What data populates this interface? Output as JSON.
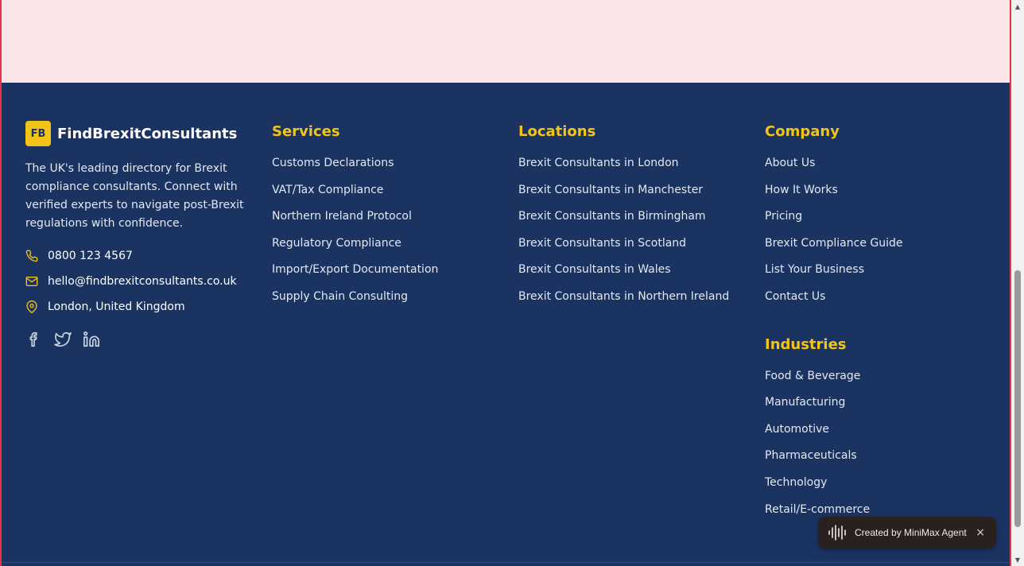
{
  "brand": {
    "badge": "FB",
    "name": "FindBrexitConsultants",
    "description": "The UK's leading directory for Brexit compliance consultants. Connect with verified experts to navigate post-Brexit regulations with confidence.",
    "phone": "0800 123 4567",
    "email": "hello@findbrexitconsultants.co.uk",
    "location": "London, United Kingdom"
  },
  "services": {
    "heading": "Services",
    "links": [
      "Customs Declarations",
      "VAT/Tax Compliance",
      "Northern Ireland Protocol",
      "Regulatory Compliance",
      "Import/Export Documentation",
      "Supply Chain Consulting"
    ]
  },
  "locations": {
    "heading": "Locations",
    "links": [
      "Brexit Consultants in London",
      "Brexit Consultants in Manchester",
      "Brexit Consultants in Birmingham",
      "Brexit Consultants in Scotland",
      "Brexit Consultants in Wales",
      "Brexit Consultants in Northern Ireland"
    ]
  },
  "company": {
    "heading": "Company",
    "links": [
      "About Us",
      "How It Works",
      "Pricing",
      "Brexit Compliance Guide",
      "List Your Business",
      "Contact Us"
    ]
  },
  "industries": {
    "heading": "Industries",
    "links": [
      "Food & Beverage",
      "Manufacturing",
      "Automotive",
      "Pharmaceuticals",
      "Technology",
      "Retail/E-commerce"
    ]
  },
  "social": [
    "facebook-icon",
    "twitter-icon",
    "linkedin-icon"
  ],
  "agent_badge": {
    "text": "Created by MiniMax Agent",
    "close": "×"
  },
  "colors": {
    "footer_bg": "#1b3361",
    "accent": "#f2c418",
    "top_band": "#fae6e6",
    "frame_border": "#e6344a"
  }
}
